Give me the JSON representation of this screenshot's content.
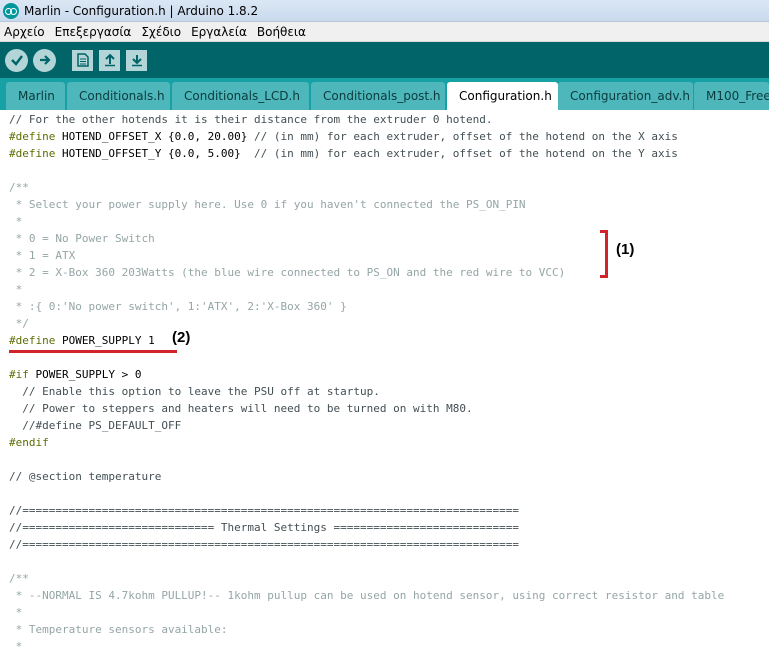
{
  "window": {
    "title": "Marlin - Configuration.h | Arduino 1.8.2"
  },
  "menu": [
    "Αρχείο",
    "Επεξεργασία",
    "Σχέδιο",
    "Εργαλεία",
    "Βοήθεια"
  ],
  "toolbar": [
    "verify-icon",
    "upload-icon",
    "new-icon",
    "open-icon",
    "save-icon"
  ],
  "tabs": [
    {
      "label": "Marlin",
      "active": false
    },
    {
      "label": "Conditionals.h",
      "active": false
    },
    {
      "label": "Conditionals_LCD.h",
      "active": false
    },
    {
      "label": "Conditionals_post.h",
      "active": false
    },
    {
      "label": "Configuration.h",
      "active": true
    },
    {
      "label": "Configuration_adv.h",
      "active": false
    },
    {
      "label": "M100_Free",
      "active": false
    }
  ],
  "code": [
    {
      "t": "// For the other hotends it is their distance from the extruder 0 hotend.",
      "k": "comment2"
    },
    {
      "t": "#define HOTEND_OFFSET_X {0.0, 20.00} // (in mm) for each extruder, offset of the hotend on the X axis",
      "k": "define"
    },
    {
      "t": "#define HOTEND_OFFSET_Y {0.0, 5.00}  // (in mm) for each extruder, offset of the hotend on the Y axis",
      "k": "define"
    },
    {
      "t": "",
      "k": "plain"
    },
    {
      "t": "/**",
      "k": "comment"
    },
    {
      "t": " * Select your power supply here. Use 0 if you haven't connected the PS_ON_PIN",
      "k": "comment"
    },
    {
      "t": " *",
      "k": "comment"
    },
    {
      "t": " * 0 = No Power Switch",
      "k": "comment"
    },
    {
      "t": " * 1 = ATX",
      "k": "comment"
    },
    {
      "t": " * 2 = X-Box 360 203Watts (the blue wire connected to PS_ON and the red wire to VCC)",
      "k": "comment"
    },
    {
      "t": " *",
      "k": "comment"
    },
    {
      "t": " * :{ 0:'No power switch', 1:'ATX', 2:'X-Box 360' }",
      "k": "comment"
    },
    {
      "t": " */",
      "k": "comment"
    },
    {
      "t": "#define POWER_SUPPLY 1",
      "k": "define"
    },
    {
      "t": "",
      "k": "plain"
    },
    {
      "t": "#if POWER_SUPPLY > 0",
      "k": "if"
    },
    {
      "t": "  // Enable this option to leave the PSU off at startup.",
      "k": "comment2"
    },
    {
      "t": "  // Power to steppers and heaters will need to be turned on with M80.",
      "k": "comment2"
    },
    {
      "t": "  //#define PS_DEFAULT_OFF",
      "k": "comment2"
    },
    {
      "t": "#endif",
      "k": "endif"
    },
    {
      "t": "",
      "k": "plain"
    },
    {
      "t": "// @section temperature",
      "k": "comment2"
    },
    {
      "t": "",
      "k": "plain"
    },
    {
      "t": "//===========================================================================",
      "k": "comment2"
    },
    {
      "t": "//============================= Thermal Settings ============================",
      "k": "comment2"
    },
    {
      "t": "//===========================================================================",
      "k": "comment2"
    },
    {
      "t": "",
      "k": "plain"
    },
    {
      "t": "/**",
      "k": "comment"
    },
    {
      "t": " * --NORMAL IS 4.7kohm PULLUP!-- 1kohm pullup can be used on hotend sensor, using correct resistor and table",
      "k": "comment"
    },
    {
      "t": " *",
      "k": "comment"
    },
    {
      "t": " * Temperature sensors available:",
      "k": "comment"
    },
    {
      "t": " *",
      "k": "comment"
    }
  ],
  "annotations": {
    "label1": "(1)",
    "label2": "(2)"
  },
  "colors": {
    "toolbar": "#006468",
    "tabbar": "#17a1a5",
    "tab": "#4db7bb",
    "annotation": "#d2232a"
  }
}
